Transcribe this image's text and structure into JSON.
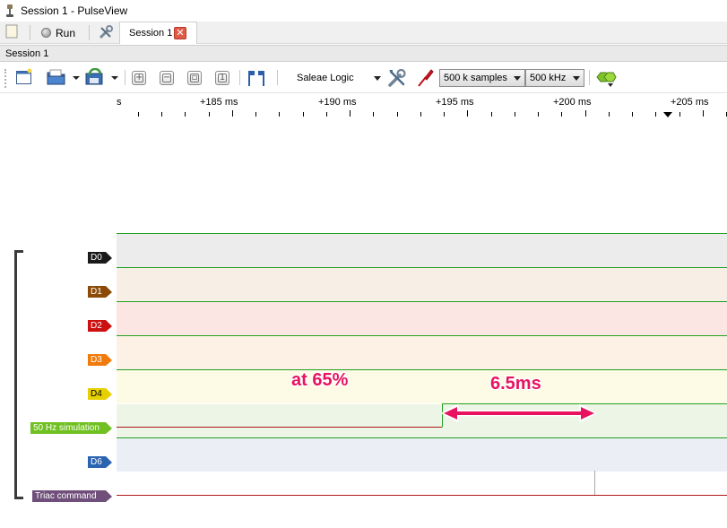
{
  "window": {
    "title": "Session 1 - PulseView"
  },
  "main_toolbar": {
    "run_label": "Run",
    "tab_label": "Session 1",
    "tab_close": "✕"
  },
  "session": {
    "header": "Session 1"
  },
  "device_toolbar": {
    "device": "Saleae Logic",
    "samples": "500 k samples",
    "samplerate": "500 kHz"
  },
  "ruler": {
    "left_label": "s",
    "labels": [
      "+185 ms",
      "+190 ms",
      "+195 ms",
      "+200 ms",
      "+205 ms"
    ]
  },
  "channels": [
    {
      "name": "D0",
      "color": "#1a1a1a"
    },
    {
      "name": "D1",
      "color": "#8b4a06"
    },
    {
      "name": "D2",
      "color": "#cc1010"
    },
    {
      "name": "D3",
      "color": "#f07a0a"
    },
    {
      "name": "D4",
      "color": "#e6d000"
    },
    {
      "name": "50 Hz simulation",
      "color": "#6fc020"
    },
    {
      "name": "D6",
      "color": "#2a63b0"
    },
    {
      "name": "Triac command",
      "color": "#70507a"
    }
  ],
  "annotations": {
    "left": "at 65%",
    "right": "6.5ms"
  },
  "colors": {
    "signal_high": "#22a022",
    "signal_low": "#b01818",
    "annotation": "#e8135f"
  }
}
